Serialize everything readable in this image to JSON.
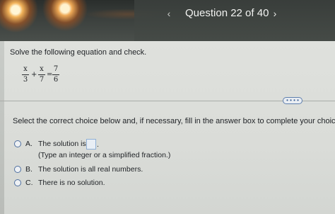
{
  "header": {
    "prev_icon": "‹",
    "title": "Question 22 of 40",
    "next_icon": "›"
  },
  "question": {
    "instruction": "Solve the following equation and check.",
    "equation": {
      "term1": {
        "num": "x",
        "den": "3"
      },
      "plus": "+",
      "term2": {
        "num": "x",
        "den": "7"
      },
      "equals": "=",
      "rhs": {
        "num": "7",
        "den": "6"
      }
    }
  },
  "more_button": "• • • •",
  "prompt": "Select the correct choice below and, if necessary, fill in the answer box to complete your choice.",
  "choices": [
    {
      "letter": "A.",
      "text": "The solution is",
      "period": ".",
      "hint": "(Type an integer or a simplified fraction.)"
    },
    {
      "letter": "B.",
      "text": "The solution is all real numbers."
    },
    {
      "letter": "C.",
      "text": "There is no solution."
    }
  ],
  "answer_value": "",
  "colors": {
    "accent": "#4e6fa0",
    "header_text": "#f2f3f1"
  }
}
